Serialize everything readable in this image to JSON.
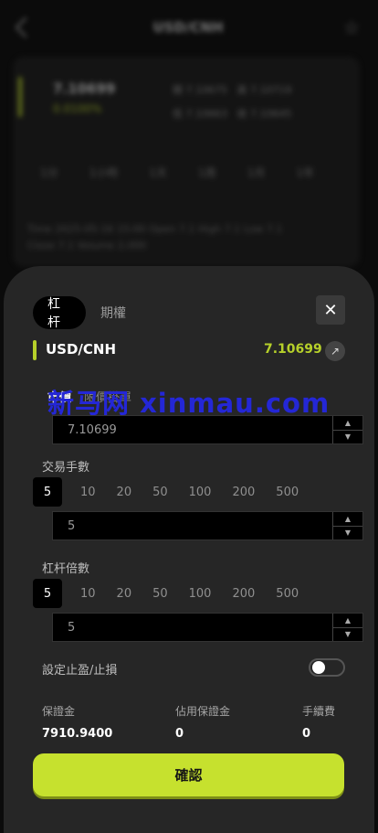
{
  "background": {
    "title": "USD/CNH",
    "price": "7.10699",
    "change": "0.0100%",
    "stats": [
      "開 7.10675",
      "高 7.10719",
      "低 7.10663",
      "收 7.10645"
    ],
    "periods": [
      "1分",
      "1小時",
      "1天",
      "1周",
      "1月",
      "1年"
    ],
    "info": "Time 2025-05-16 15:00  Open 7.1  High 7.1  Low 7.1  Close 7.1  Volume 2,000"
  },
  "tabs": [
    {
      "label": "杠杆",
      "active": true
    },
    {
      "label": "期權",
      "active": false
    }
  ],
  "close_icon": "close-icon",
  "symbol": "USD/CNH",
  "quote": "7.10699",
  "order_types": {
    "market": "市價",
    "limit": "限價掛單"
  },
  "watermark": "新马网 xinmau.com",
  "price_input": {
    "value": "7.10699"
  },
  "quantity": {
    "label": "交易手數",
    "selected": "5",
    "options": [
      "10",
      "20",
      "50",
      "100",
      "200",
      "500"
    ],
    "value": "5"
  },
  "leverage": {
    "label": "杠杆倍數",
    "selected": "5",
    "options": [
      "10",
      "20",
      "50",
      "100",
      "200",
      "500"
    ],
    "value": "5"
  },
  "stop_toggle": {
    "label": "設定止盈/止損",
    "on": false
  },
  "summary": [
    {
      "label": "保證金",
      "value": "7910.9400"
    },
    {
      "label": "佔用保證金",
      "value": "0"
    },
    {
      "label": "手續費",
      "value": "0"
    }
  ],
  "confirm_label": "確認",
  "colors": {
    "accent": "#c6e12e",
    "sheet": "#262626",
    "watermark": "#2427d6"
  }
}
